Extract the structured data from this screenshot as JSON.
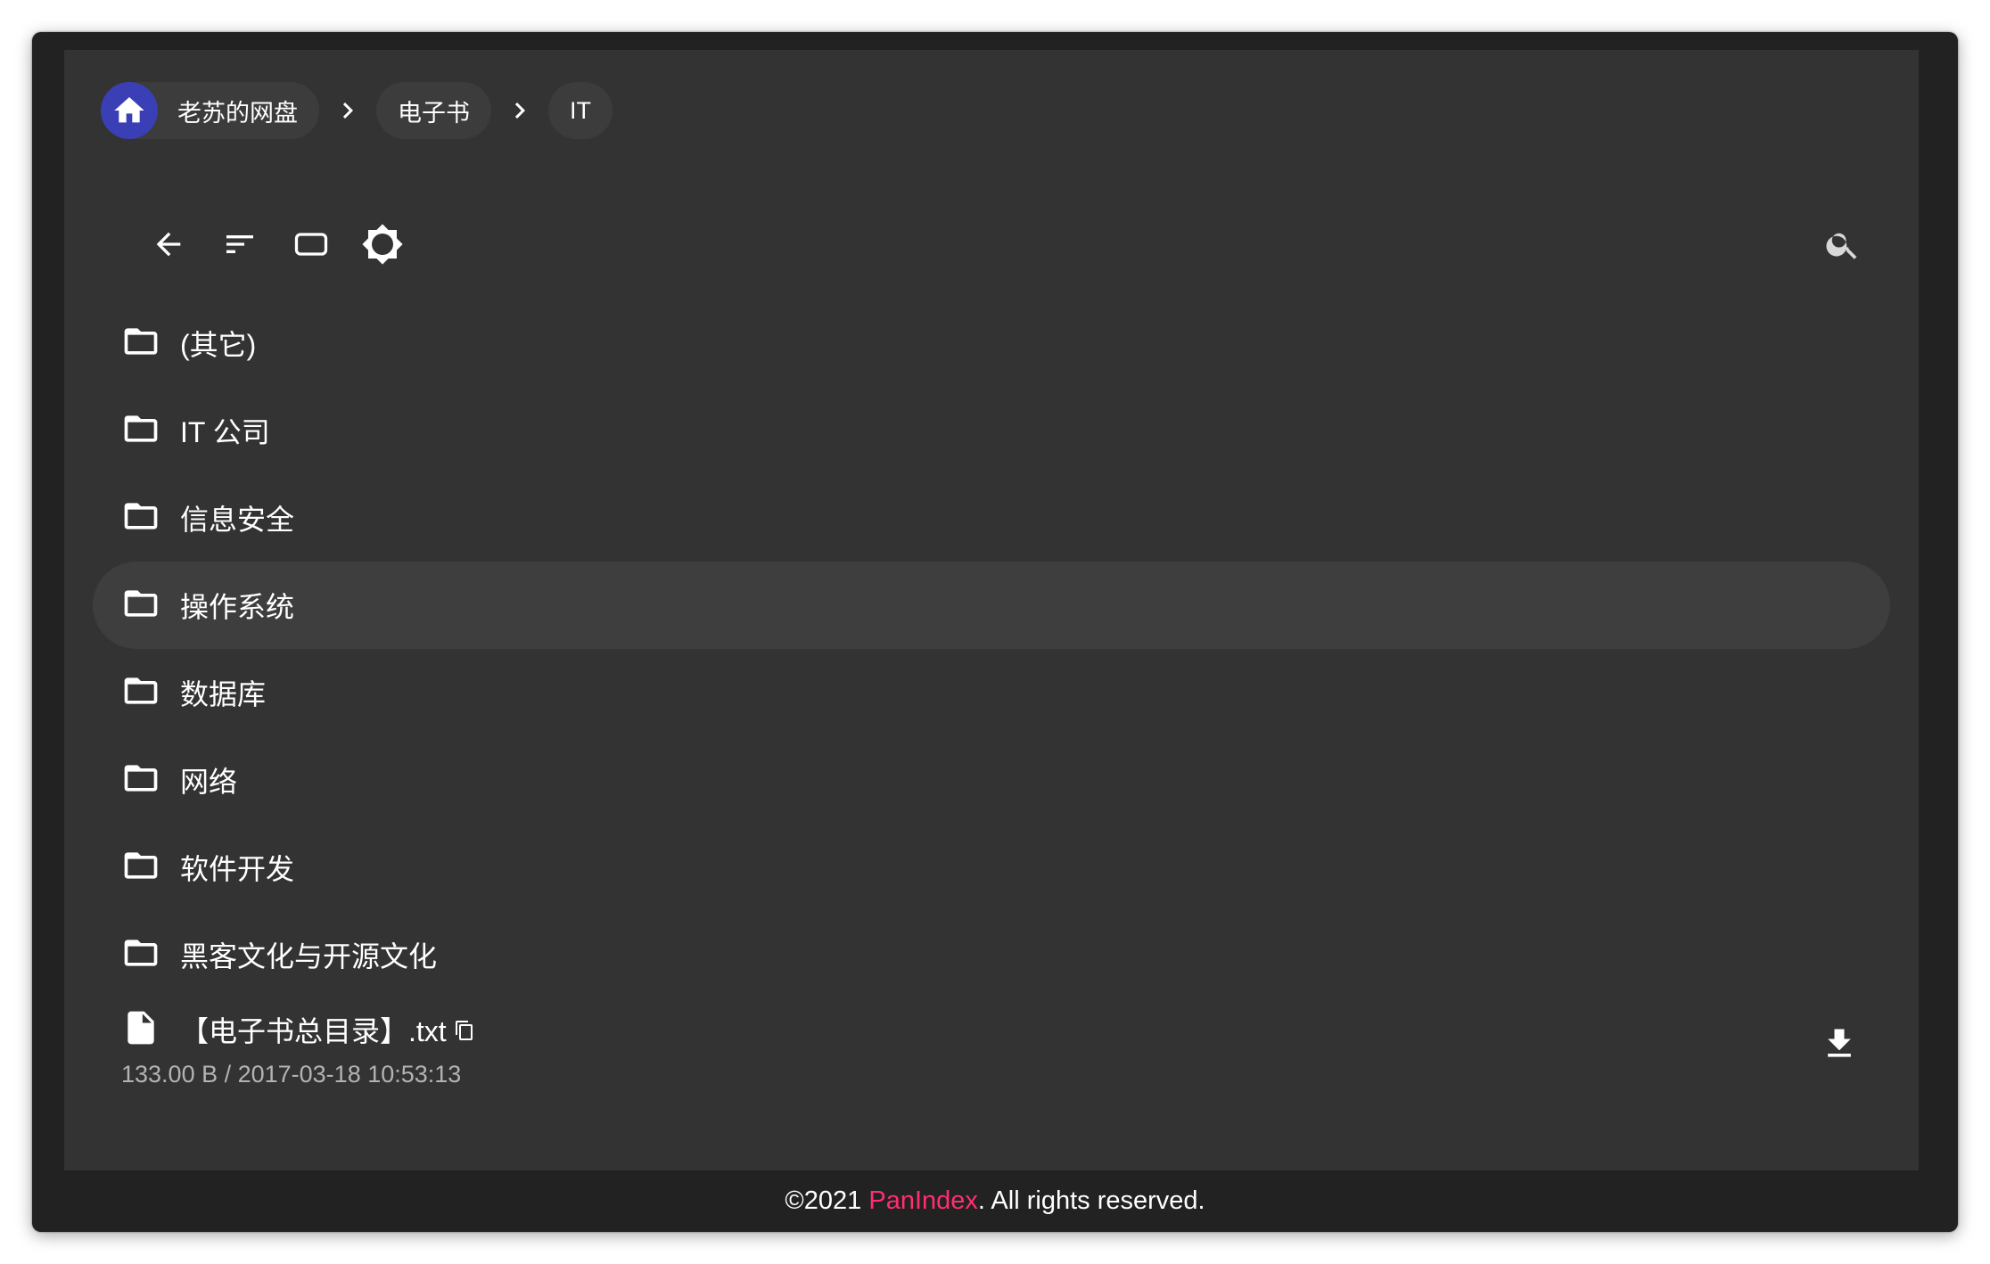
{
  "breadcrumb": {
    "items": [
      {
        "label": "老苏的网盘"
      },
      {
        "label": "电子书"
      },
      {
        "label": "IT"
      }
    ]
  },
  "toolbar": {
    "back_icon": "arrow-left-icon",
    "sort_icon": "sort-icon",
    "view_icon": "view-mode-icon",
    "theme_icon": "brightness-icon",
    "search_icon": "search-icon"
  },
  "folders": [
    {
      "name": "(其它)"
    },
    {
      "name": "IT 公司"
    },
    {
      "name": "信息安全"
    },
    {
      "name": "操作系统"
    },
    {
      "name": "数据库"
    },
    {
      "name": "网络"
    },
    {
      "name": "软件开发"
    },
    {
      "name": "黑客文化与开源文化"
    }
  ],
  "files": [
    {
      "name": "【电子书总目录】.txt",
      "meta": "133.00 B / 2017-03-18 10:53:13"
    }
  ],
  "footer": {
    "prefix": "©2021 ",
    "brand": "PanIndex",
    "suffix": ". All rights reserved."
  },
  "colors": {
    "background": "#222222",
    "panel": "#333333",
    "accent": "#3a3fb5",
    "brand": "#ff2e6f"
  }
}
